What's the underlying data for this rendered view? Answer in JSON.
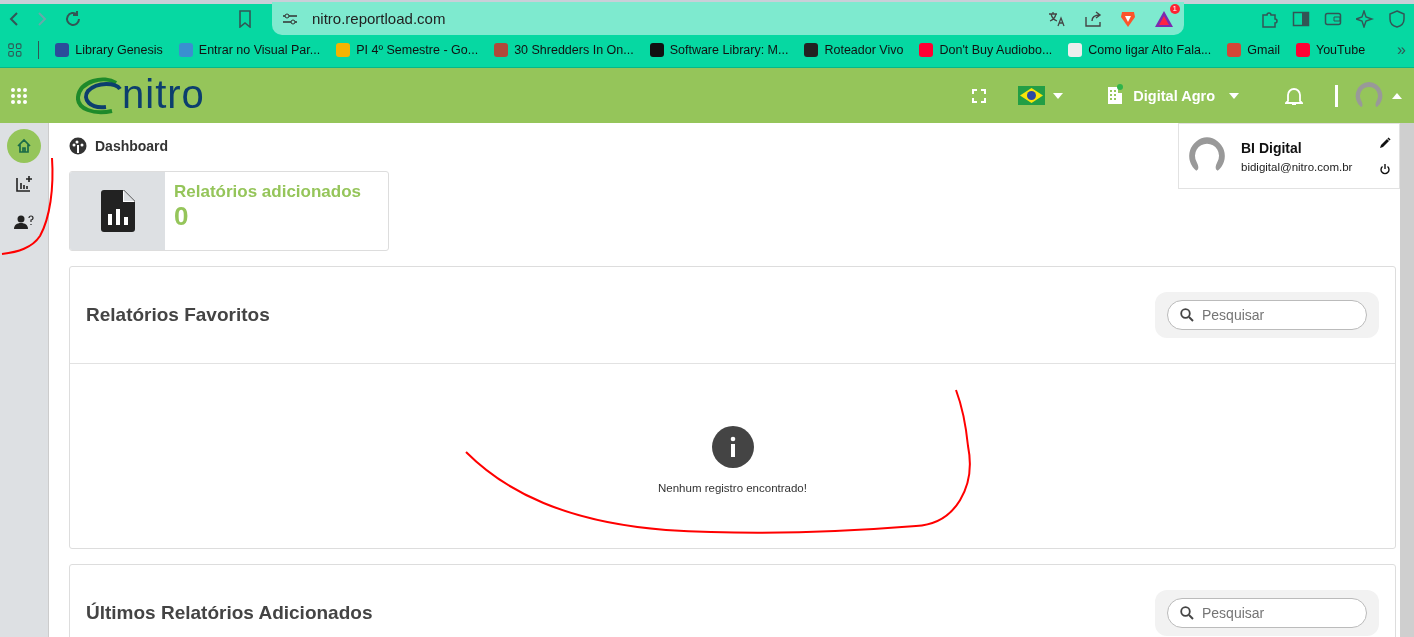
{
  "browser": {
    "url": "nitro.reportload.com",
    "brave_badge": "1",
    "bookmarks": [
      "Library Genesis",
      "Entrar no Visual Par...",
      "PI 4º Semestre - Go...",
      "30 Shredders In On...",
      "Software Library: M...",
      "Roteador Vivo",
      "Don't Buy Audiobo...",
      "Como ligar Alto Fala...",
      "Gmail",
      "YouTube"
    ],
    "more": "»"
  },
  "header": {
    "logo": "nitro",
    "company": "Digital Agro"
  },
  "profile_menu": {
    "name": "BI Digital",
    "email": "bidigital@nitro.com.br"
  },
  "sidebar": [
    {
      "kind": "home",
      "selected": true
    },
    {
      "kind": "add-report",
      "selected": false
    },
    {
      "kind": "user-help",
      "selected": false
    }
  ],
  "breadcrumb": "Dashboard",
  "stat_card": {
    "label": "Relatórios adicionados",
    "value": "0"
  },
  "panels": [
    {
      "title": "Relatórios Favoritos",
      "search_placeholder": "Pesquisar",
      "empty_message": "Nenhum registro encontrado!"
    },
    {
      "title": "Últimos Relatórios Adicionados",
      "search_placeholder": "Pesquisar"
    }
  ]
}
